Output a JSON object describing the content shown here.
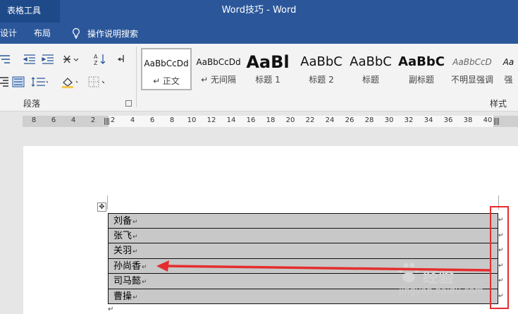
{
  "title_bar": {
    "context_tab": "表格工具",
    "title": "Word技巧 - Word"
  },
  "tabs": {
    "design": "设计",
    "layout": "布局",
    "tell_me": "操作说明搜索"
  },
  "ribbon": {
    "paragraph_group": "段落",
    "styles_group": "样式",
    "styles": [
      {
        "preview": "AaBbCcDd",
        "label": "↵ 正文",
        "selected": true
      },
      {
        "preview": "AaBbCcDd",
        "label": "↵ 无间隔"
      },
      {
        "preview": "AaBl",
        "label": "标题 1"
      },
      {
        "preview": "AaBbC",
        "label": "标题 2"
      },
      {
        "preview": "AaBbC",
        "label": "标题"
      },
      {
        "preview": "AaBbC",
        "label": "副标题"
      },
      {
        "preview": "AaBbCcD",
        "label": "不明显强调"
      },
      {
        "preview": "Aa",
        "label": "强"
      }
    ]
  },
  "ruler": {
    "left_numbers": [
      "8",
      "6",
      "4",
      "2"
    ],
    "right_numbers": [
      "2",
      "4",
      "6",
      "8",
      "10",
      "12",
      "14",
      "16",
      "18",
      "20",
      "22",
      "24",
      "26",
      "28",
      "30",
      "32",
      "34",
      "36",
      "38",
      "40"
    ]
  },
  "table": {
    "rows": [
      "刘备",
      "张飞",
      "关羽",
      "孙尚香",
      "司马懿",
      "曹操"
    ],
    "cell_mark": "↵"
  },
  "annotation": {
    "box_color": "#e52d2d",
    "arrow_color": "#e52d2d"
  },
  "watermark": {
    "brand": "经验",
    "url": "jingyan.baidu.com"
  },
  "colors": {
    "word_blue": "#2b579a",
    "table_shading": "#c8c8c8"
  }
}
